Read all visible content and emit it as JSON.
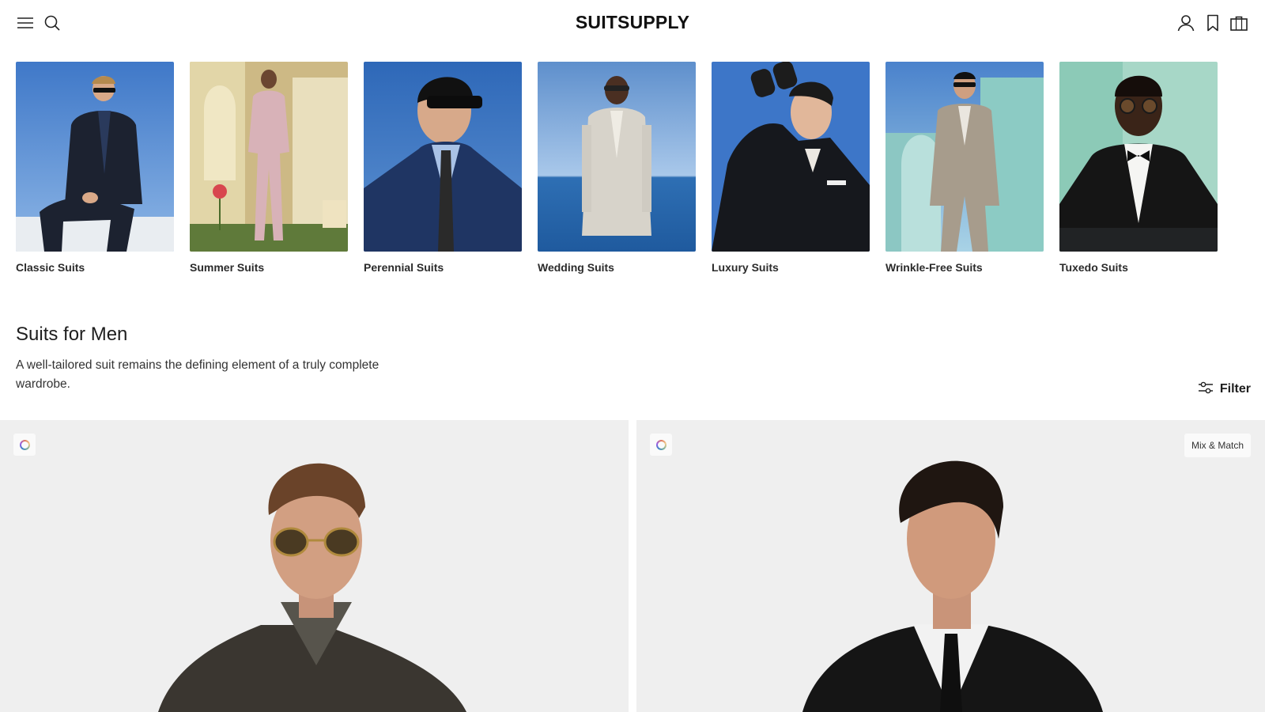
{
  "brand": {
    "logo_text": "SUITSUPPLY"
  },
  "header": {
    "left_icons": [
      "menu-icon",
      "search-icon"
    ],
    "right_icons": [
      "account-icon",
      "bookmark-icon",
      "bag-icon"
    ]
  },
  "categories": [
    {
      "label": "Classic Suits"
    },
    {
      "label": "Summer Suits"
    },
    {
      "label": "Perennial Suits"
    },
    {
      "label": "Wedding Suits"
    },
    {
      "label": "Luxury Suits"
    },
    {
      "label": "Wrinkle-Free Suits"
    },
    {
      "label": "Tuxedo Suits"
    }
  ],
  "page": {
    "title": "Suits for Men",
    "description": "A well-tailored suit remains the defining element of a truly complete wardrobe.",
    "filter_label": "Filter"
  },
  "products": [
    {
      "badge": ""
    },
    {
      "badge": "Mix & Match"
    }
  ],
  "colors": {
    "tile_bg": "#efefef",
    "sky_blue": "#4b7fc4",
    "text_dark": "#1e1e1e"
  }
}
